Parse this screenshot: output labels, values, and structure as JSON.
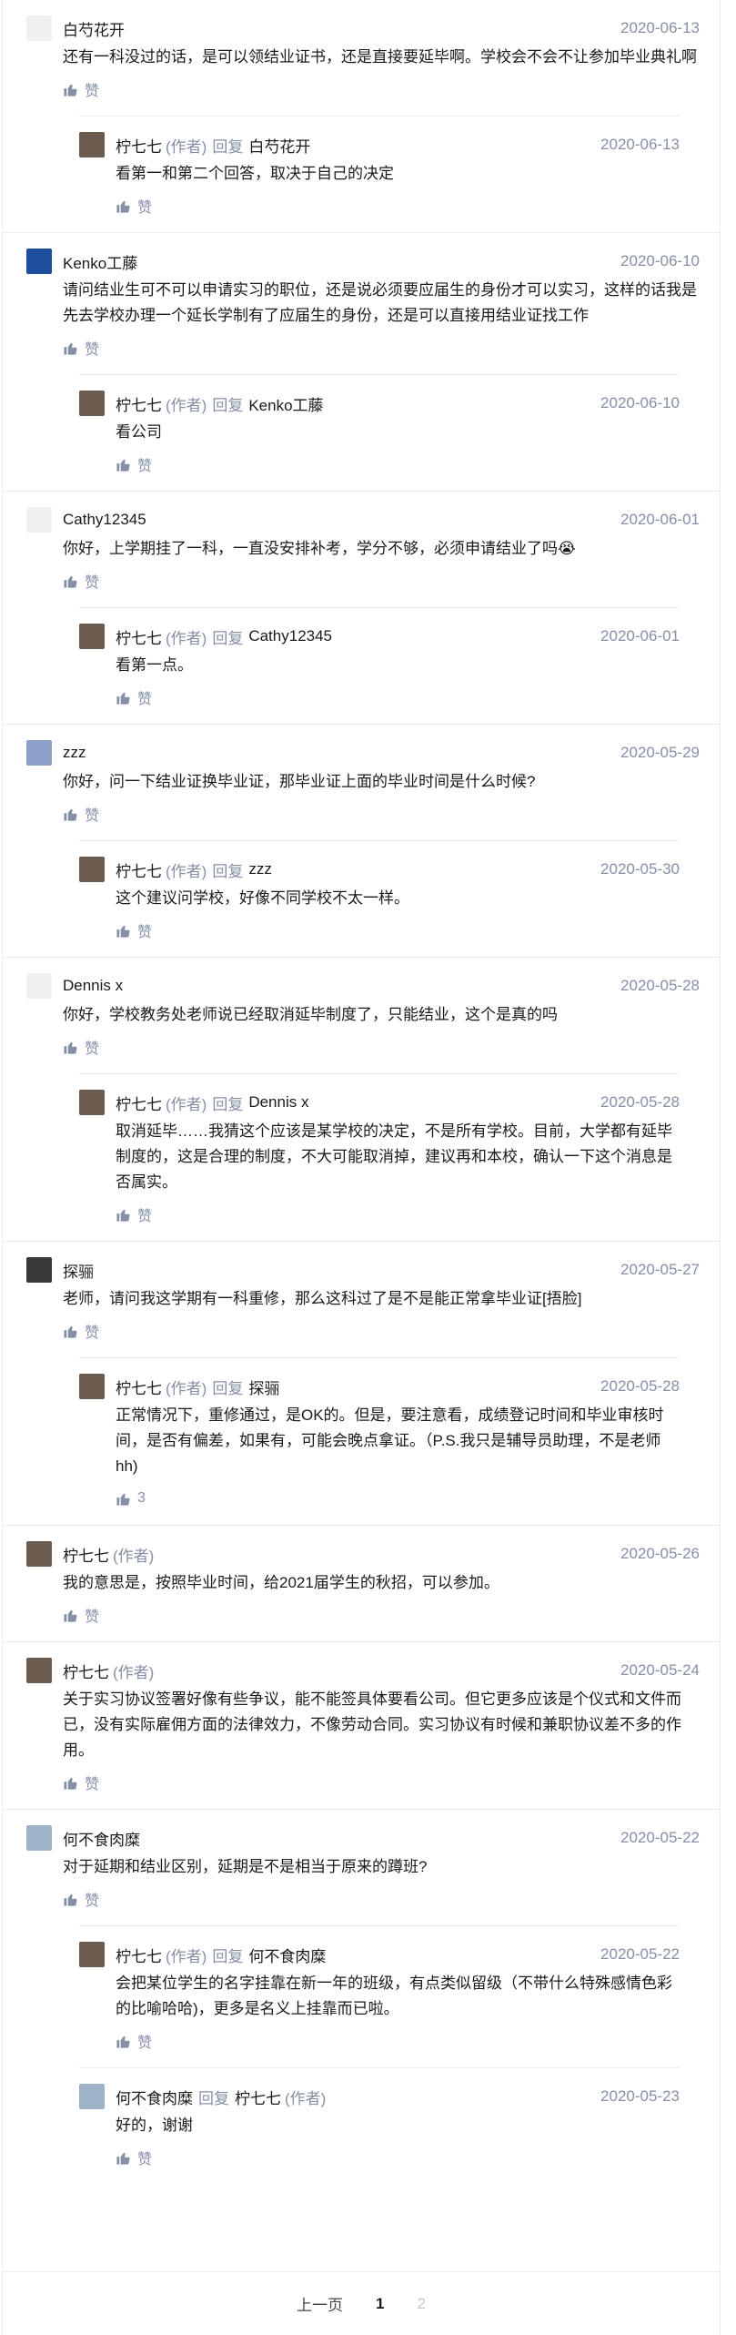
{
  "labels": {
    "like": "赞",
    "author_tag": "(作者)",
    "reply_verb": "回复"
  },
  "comments": [
    {
      "name": "白芍花开",
      "date": "2020-06-13",
      "text": "还有一科没过的话，是可以领结业证书，还是直接要延毕啊。学校会不会不让参加毕业典礼啊",
      "likes": "",
      "avatar_color": "#f0f0f0",
      "replies": [
        {
          "name": "柠七七",
          "to": "白芍花开",
          "date": "2020-06-13",
          "text": "看第一和第二个回答，取决于自己的决定",
          "likes": ""
        }
      ]
    },
    {
      "name": "Kenko工藤",
      "date": "2020-06-10",
      "text": "请问结业生可不可以申请实习的职位，还是说必须要应届生的身份才可以实习，这样的话我是先去学校办理一个延长学制有了应届生的身份，还是可以直接用结业证找工作",
      "likes": "",
      "avatar_color": "#1d4f9c",
      "replies": [
        {
          "name": "柠七七",
          "to": "Kenko工藤",
          "date": "2020-06-10",
          "text": "看公司",
          "likes": ""
        }
      ]
    },
    {
      "name": "Cathy12345",
      "date": "2020-06-01",
      "text": "你好，上学期挂了一科，一直没安排补考，学分不够，必须申请结业了吗😭",
      "likes": "",
      "avatar_color": "#f0f0f0",
      "replies": [
        {
          "name": "柠七七",
          "to": "Cathy12345",
          "date": "2020-06-01",
          "text": "看第一点。",
          "likes": ""
        }
      ]
    },
    {
      "name": "zzz",
      "date": "2020-05-29",
      "text": "你好，问一下结业证换毕业证，那毕业证上面的毕业时间是什么时候?",
      "likes": "",
      "avatar_color": "#8aa0c8",
      "replies": [
        {
          "name": "柠七七",
          "to": "zzz",
          "date": "2020-05-30",
          "text": "这个建议问学校，好像不同学校不太一样。",
          "likes": ""
        }
      ]
    },
    {
      "name": "Dennis x",
      "date": "2020-05-28",
      "text": "你好，学校教务处老师说已经取消延毕制度了，只能结业，这个是真的吗",
      "likes": "",
      "avatar_color": "#f0f0f0",
      "replies": [
        {
          "name": "柠七七",
          "to": "Dennis x",
          "date": "2020-05-28",
          "text": "取消延毕……我猜这个应该是某学校的决定，不是所有学校。目前，大学都有延毕制度的，这是合理的制度，不大可能取消掉，建议再和本校，确认一下这个消息是否属实。",
          "likes": ""
        }
      ]
    },
    {
      "name": "探骊",
      "date": "2020-05-27",
      "text": "老师，请问我这学期有一科重修，那么这科过了是不是能正常拿毕业证[捂脸]",
      "likes": "",
      "avatar_color": "#3a3a3a",
      "replies": [
        {
          "name": "柠七七",
          "to": "探骊",
          "date": "2020-05-28",
          "text": "正常情况下，重修通过，是OK的。但是，要注意看，成绩登记时间和毕业审核时间，是否有偏差，如果有，可能会晚点拿证。（P.S.我只是辅导员助理，不是老师hh)",
          "likes": "3"
        }
      ]
    },
    {
      "name": "柠七七",
      "author": true,
      "date": "2020-05-26",
      "text": "我的意思是，按照毕业时间，给2021届学生的秋招，可以参加。",
      "likes": "",
      "avatar_color": "#6b5a4e",
      "replies": []
    },
    {
      "name": "柠七七",
      "author": true,
      "date": "2020-05-24",
      "text": "关于实习协议签署好像有些争议，能不能签具体要看公司。但它更多应该是个仪式和文件而已，没有实际雇佣方面的法律效力，不像劳动合同。实习协议有时候和兼职协议差不多的作用。",
      "likes": "",
      "avatar_color": "#6b5a4e",
      "replies": []
    },
    {
      "name": "何不食肉糜",
      "date": "2020-05-22",
      "text": "对于延期和结业区别，延期是不是相当于原来的蹲班?",
      "likes": "",
      "avatar_color": "#9fb3c8",
      "replies": [
        {
          "name": "柠七七",
          "to": "何不食肉糜",
          "date": "2020-05-22",
          "text": "会把某位学生的名字挂靠在新一年的班级，有点类似留级（不带什么特殊感情色彩的比喻哈哈)，更多是名义上挂靠而已啦。",
          "likes": ""
        },
        {
          "name": "何不食肉糜",
          "to": "柠七七",
          "to_author": true,
          "date": "2020-05-23",
          "text": "好的，谢谢",
          "likes": "",
          "avatar_color": "#9fb3c8"
        }
      ]
    }
  ],
  "pagination": {
    "prev": "上一页",
    "current": "1",
    "next": "2"
  }
}
